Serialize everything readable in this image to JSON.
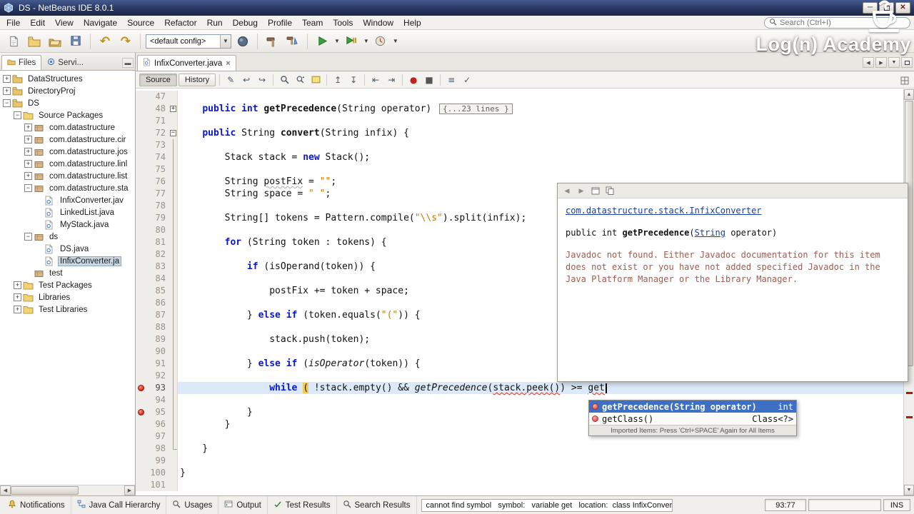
{
  "titlebar": {
    "title": "DS - NetBeans IDE 8.0.1"
  },
  "menubar": {
    "items": [
      "File",
      "Edit",
      "View",
      "Navigate",
      "Source",
      "Refactor",
      "Run",
      "Debug",
      "Profile",
      "Team",
      "Tools",
      "Window",
      "Help"
    ]
  },
  "search": {
    "placeholder": "Search (Ctrl+I)"
  },
  "toolbar": {
    "config": "<default config>"
  },
  "brand": {
    "name": "Log(n) Academy"
  },
  "explorer": {
    "tabs": [
      {
        "label": "Files"
      },
      {
        "label": "Servi..."
      }
    ],
    "tree": [
      {
        "label": "DataStructures",
        "depth": 0,
        "icon": "project",
        "handle": "plus"
      },
      {
        "label": "DirectoryProj",
        "depth": 0,
        "icon": "project",
        "handle": "plus"
      },
      {
        "label": "DS",
        "depth": 0,
        "icon": "project",
        "handle": "minus"
      },
      {
        "label": "Source Packages",
        "depth": 1,
        "icon": "folder",
        "handle": "minus"
      },
      {
        "label": "com.datastructure",
        "depth": 2,
        "icon": "package",
        "handle": "plus"
      },
      {
        "label": "com.datastructure.cir",
        "depth": 2,
        "icon": "package",
        "handle": "plus"
      },
      {
        "label": "com.datastructure.jos",
        "depth": 2,
        "icon": "package",
        "handle": "plus"
      },
      {
        "label": "com.datastructure.linl",
        "depth": 2,
        "icon": "package",
        "handle": "plus"
      },
      {
        "label": "com.datastructure.list",
        "depth": 2,
        "icon": "package",
        "handle": "plus"
      },
      {
        "label": "com.datastructure.sta",
        "depth": 2,
        "icon": "package",
        "handle": "minus"
      },
      {
        "label": "InfixConverter.jav",
        "depth": 3,
        "icon": "java"
      },
      {
        "label": "LinkedList.java",
        "depth": 3,
        "icon": "java"
      },
      {
        "label": "MyStack.java",
        "depth": 3,
        "icon": "java"
      },
      {
        "label": "ds",
        "depth": 2,
        "icon": "package",
        "handle": "minus"
      },
      {
        "label": "DS.java",
        "depth": 3,
        "icon": "java"
      },
      {
        "label": "InfixConverter.ja",
        "depth": 3,
        "icon": "java",
        "selected": true
      },
      {
        "label": "test",
        "depth": 2,
        "icon": "package"
      },
      {
        "label": "Test Packages",
        "depth": 1,
        "icon": "folder",
        "handle": "plus"
      },
      {
        "label": "Libraries",
        "depth": 1,
        "icon": "folder",
        "handle": "plus"
      },
      {
        "label": "Test Libraries",
        "depth": 1,
        "icon": "folder",
        "handle": "plus"
      }
    ]
  },
  "editor": {
    "tab": {
      "label": "InfixConverter.java"
    },
    "toolbar": {
      "source_label": "Source",
      "history_label": "History"
    },
    "lines": [
      {
        "n": 47,
        "s": []
      },
      {
        "n": 48,
        "fold": "plus",
        "s": [
          [
            "    "
          ],
          [
            "public",
            "kw"
          ],
          [
            " "
          ],
          [
            "int",
            "kw"
          ],
          [
            " "
          ],
          [
            "getPrecedence",
            "decl"
          ],
          [
            "(String operator) "
          ],
          [
            "{...23 lines }",
            "fold"
          ]
        ]
      },
      {
        "n": 71,
        "s": []
      },
      {
        "n": 72,
        "fold": "minus",
        "s": [
          [
            "    "
          ],
          [
            "public",
            "kw"
          ],
          [
            " String "
          ],
          [
            "convert",
            "decl"
          ],
          [
            "(String infix) {"
          ]
        ]
      },
      {
        "n": 73,
        "fold": "line",
        "s": []
      },
      {
        "n": 74,
        "fold": "line",
        "s": [
          [
            "        Stack stack = "
          ],
          [
            "new",
            "kw"
          ],
          [
            " Stack();"
          ]
        ]
      },
      {
        "n": 75,
        "fold": "line",
        "s": []
      },
      {
        "n": 76,
        "fold": "line",
        "s": [
          [
            "        String "
          ],
          [
            "postFix",
            "warn"
          ],
          [
            " = "
          ],
          [
            "\"\"",
            "str"
          ],
          [
            ";"
          ]
        ]
      },
      {
        "n": 77,
        "fold": "line",
        "s": [
          [
            "        String space = "
          ],
          [
            "\" \"",
            "str"
          ],
          [
            ";"
          ]
        ]
      },
      {
        "n": 78,
        "fold": "line",
        "s": []
      },
      {
        "n": 79,
        "fold": "line",
        "s": [
          [
            "        String[] tokens = Pattern.compile("
          ],
          [
            "\"\\\\s\"",
            "str"
          ],
          [
            ").split(infix);"
          ]
        ]
      },
      {
        "n": 80,
        "fold": "line",
        "s": []
      },
      {
        "n": 81,
        "fold": "line",
        "s": [
          [
            "        "
          ],
          [
            "for",
            "kw"
          ],
          [
            " (String token : tokens) {"
          ]
        ]
      },
      {
        "n": 82,
        "fold": "line",
        "s": []
      },
      {
        "n": 83,
        "fold": "line",
        "s": [
          [
            "            "
          ],
          [
            "if",
            "kw"
          ],
          [
            " (isOperand(token)) {"
          ]
        ]
      },
      {
        "n": 84,
        "fold": "line",
        "s": []
      },
      {
        "n": 85,
        "fold": "line",
        "s": [
          [
            "                postFix += token + space;"
          ]
        ]
      },
      {
        "n": 86,
        "fold": "line",
        "s": []
      },
      {
        "n": 87,
        "fold": "line",
        "s": [
          [
            "            } "
          ],
          [
            "else",
            "kw"
          ],
          [
            " "
          ],
          [
            "if",
            "kw"
          ],
          [
            " (token.equals("
          ],
          [
            "\"(\"",
            "str"
          ],
          [
            ")) {"
          ]
        ]
      },
      {
        "n": 88,
        "fold": "line",
        "s": []
      },
      {
        "n": 89,
        "fold": "line",
        "s": [
          [
            "                stack.push(token);"
          ]
        ]
      },
      {
        "n": 90,
        "fold": "line",
        "s": []
      },
      {
        "n": 91,
        "fold": "line",
        "s": [
          [
            "            } "
          ],
          [
            "else",
            "kw"
          ],
          [
            " "
          ],
          [
            "if",
            "kw"
          ],
          [
            " ("
          ],
          [
            "isOperator",
            "it"
          ],
          [
            "(token)) {"
          ]
        ]
      },
      {
        "n": 92,
        "fold": "line",
        "s": []
      },
      {
        "n": 93,
        "fold": "line",
        "cur": true,
        "err": true,
        "s": [
          [
            "                "
          ],
          [
            "while",
            "kw"
          ],
          [
            " "
          ],
          [
            "(",
            "brace"
          ],
          [
            " !stack.empty() && "
          ],
          [
            "getPrecedence",
            "it"
          ],
          [
            "("
          ],
          [
            "stack.peek()",
            "errt"
          ],
          [
            ") >= "
          ],
          [
            "get",
            "errt"
          ],
          [
            "",
            "caret"
          ]
        ]
      },
      {
        "n": 94,
        "fold": "line",
        "s": []
      },
      {
        "n": 95,
        "fold": "line",
        "err": true,
        "s": [
          [
            "            }"
          ]
        ]
      },
      {
        "n": 96,
        "fold": "line",
        "s": [
          [
            "        }"
          ]
        ]
      },
      {
        "n": 97,
        "fold": "line",
        "s": []
      },
      {
        "n": 98,
        "fold": "end",
        "s": [
          [
            "    }"
          ]
        ]
      },
      {
        "n": 99,
        "s": []
      },
      {
        "n": 100,
        "s": [
          [
            "}"
          ]
        ]
      },
      {
        "n": 101,
        "s": []
      }
    ]
  },
  "javadoc": {
    "link": "com.datastructure.stack.InfixConverter",
    "sig": {
      "pre": "public int ",
      "name": "getPrecedence",
      "open": "(",
      "param_type": "String",
      "post": " operator)"
    },
    "body": "Javadoc not found. Either Javadoc documentation for this item does not exist or you have not added specified Javadoc in the Java Platform Manager or the Library Manager."
  },
  "completion": {
    "items": [
      {
        "label": "getPrecedence(String operator)",
        "type": "int",
        "selected": true
      },
      {
        "label": "getClass()",
        "type": "Class<?>",
        "selected": false
      }
    ],
    "footer": "Imported Items: Press 'Ctrl+SPACE' Again for All Items"
  },
  "statusbar": {
    "buttons": [
      {
        "label": "Notifications",
        "icon": "bell"
      },
      {
        "label": "Java Call Hierarchy",
        "icon": "hierarchy"
      },
      {
        "label": "Usages",
        "icon": "usages"
      },
      {
        "label": "Output",
        "icon": "output"
      },
      {
        "label": "Test Results",
        "icon": "test"
      },
      {
        "label": "Search Results",
        "icon": "searchres"
      }
    ],
    "message": "cannot find symbol   symbol:   variable get   location:  class InfixConverter",
    "position": "93:77",
    "mode": "INS"
  },
  "colors": {
    "accent": "#3d6fc4",
    "error": "#d6281a",
    "keyword": "#0a16cf",
    "string": "#ce7b00",
    "titlebar": "#27355f"
  }
}
